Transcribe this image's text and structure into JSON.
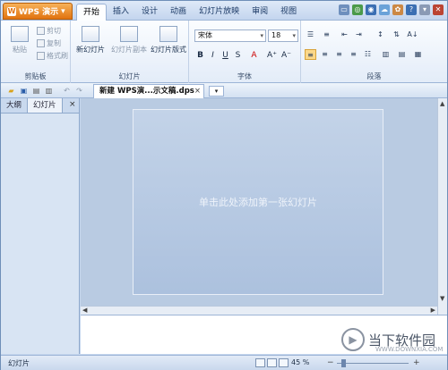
{
  "app": {
    "name": "WPS 演示",
    "logo": "W"
  },
  "tabs": [
    "开始",
    "插入",
    "设计",
    "动画",
    "幻灯片放映",
    "审阅",
    "视图"
  ],
  "clipboard": {
    "paste": "粘贴",
    "cut": "剪切",
    "copy": "复制",
    "format_painter": "格式刷",
    "label": "剪贴板"
  },
  "slides_group": {
    "new_slide": "新幻灯片",
    "slide_copy": "幻灯片副本",
    "slide_layout": "幻灯片版式",
    "label": "幻灯片"
  },
  "font": {
    "name": "宋体",
    "size": "18",
    "label": "字体"
  },
  "paragraph": {
    "label": "段落"
  },
  "document": {
    "tab_title": "新建 WPS演...示文稿.dps",
    "close": "×"
  },
  "panel": {
    "tabs": [
      "大纲",
      "幻灯片"
    ],
    "close": "×"
  },
  "slide": {
    "placeholder": "单击此处添加第一张幻灯片"
  },
  "status": {
    "left": "幻灯片",
    "zoom": "45 %"
  },
  "watermark": {
    "text": "当下软件园",
    "url": "WWW.DOWNXIA.COM"
  },
  "colors": {
    "accent": "#e1730f",
    "ribbon": "#e3ecf8",
    "slide": "#b9cbe2"
  }
}
